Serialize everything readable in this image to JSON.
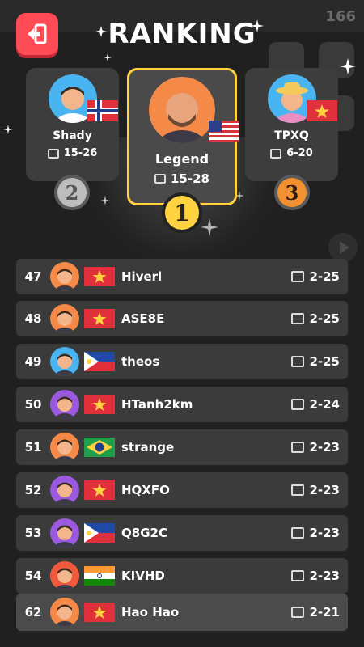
{
  "header": {
    "title": "RANKING",
    "coins": "166"
  },
  "podium": [
    {
      "place": "2",
      "name": "Shady",
      "score": "15-26",
      "flag": "norway",
      "avatar_bg": "#48b4f2"
    },
    {
      "place": "1",
      "name": "Legend",
      "score": "15-28",
      "flag": "usa",
      "avatar_bg": "#f58a48"
    },
    {
      "place": "3",
      "name": "TPXQ",
      "score": "6-20",
      "flag": "vietnam",
      "avatar_bg": "#48b4f2"
    }
  ],
  "rows": [
    {
      "rank": "47",
      "name": "Hiverl",
      "score": "2-25",
      "flag": "vietnam",
      "avatar_bg": "#f58a48"
    },
    {
      "rank": "48",
      "name": "ASE8E",
      "score": "2-25",
      "flag": "vietnam",
      "avatar_bg": "#f58a48"
    },
    {
      "rank": "49",
      "name": "theos",
      "score": "2-25",
      "flag": "philippines",
      "avatar_bg": "#48b4f2"
    },
    {
      "rank": "50",
      "name": "HTanh2km",
      "score": "2-24",
      "flag": "vietnam",
      "avatar_bg": "#9b59e0"
    },
    {
      "rank": "51",
      "name": "strange",
      "score": "2-23",
      "flag": "brazil",
      "avatar_bg": "#f58a48"
    },
    {
      "rank": "52",
      "name": "HQXFO",
      "score": "2-23",
      "flag": "vietnam",
      "avatar_bg": "#9b59e0"
    },
    {
      "rank": "53",
      "name": "Q8G2C",
      "score": "2-23",
      "flag": "philippines",
      "avatar_bg": "#9b59e0"
    },
    {
      "rank": "54",
      "name": "KIVHD",
      "score": "2-23",
      "flag": "india",
      "avatar_bg": "#f05a3c"
    },
    {
      "rank": "62",
      "name": "Hao Hao",
      "score": "2-21",
      "flag": "vietnam",
      "avatar_bg": "#f58a48",
      "current_user": true
    }
  ],
  "colors": {
    "accent_red": "#ff4b55",
    "gold": "#ffd23f",
    "bronze": "#f39030",
    "silver": "#bdbdbd"
  }
}
